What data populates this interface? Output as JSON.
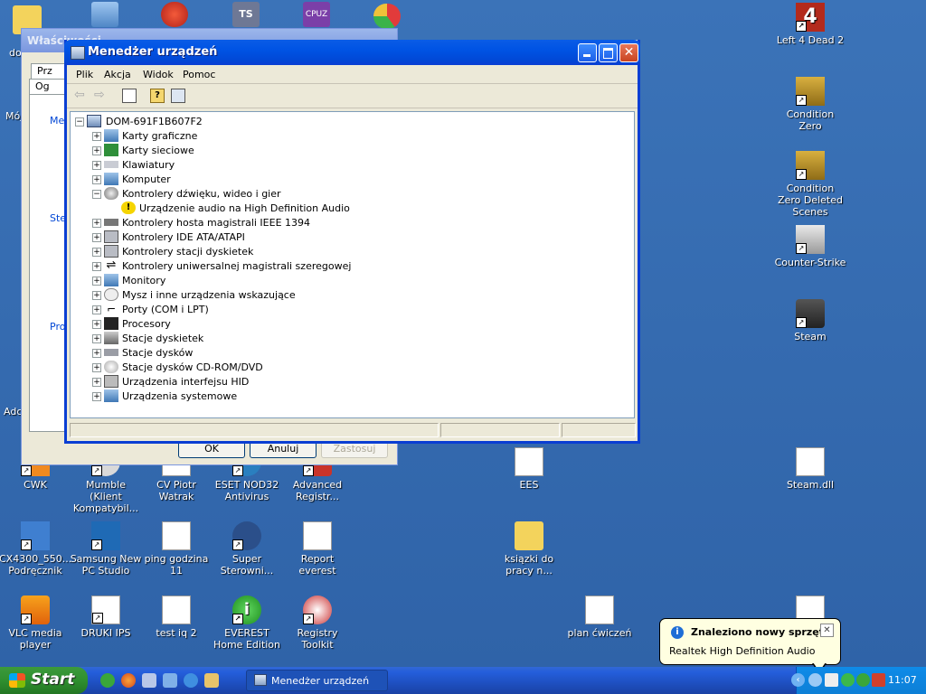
{
  "desktop": {
    "icons_right": [
      {
        "label": "Left 4 Dead 2",
        "icon": "left4dead2-icon"
      },
      {
        "label": "Condition Zero",
        "icon": "condition-zero-icon"
      },
      {
        "label": "Condition Zero Deleted Scenes",
        "icon": "condition-zero-deleted-icon"
      },
      {
        "label": "Counter-Strike",
        "icon": "counter-strike-icon"
      },
      {
        "label": "Steam",
        "icon": "steam-icon"
      },
      {
        "label": "Steam.dll",
        "icon": "dll-file-icon"
      }
    ],
    "icons_row1": [
      {
        "label": "CWK"
      },
      {
        "label": "Mumble (Klient Kompatybil..."
      },
      {
        "label": "CV Piotr Watrak"
      },
      {
        "label": "ESET NOD32 Antivirus"
      },
      {
        "label": "Advanced Registr..."
      },
      {
        "label": "EES"
      }
    ],
    "icons_row2": [
      {
        "label": "CX4300_550... Podręcznik"
      },
      {
        "label": "Samsung New PC Studio"
      },
      {
        "label": "ping godzina 11"
      },
      {
        "label": "Super Sterowni..."
      },
      {
        "label": "Report everest"
      },
      {
        "label": "ksiązki do pracy n..."
      }
    ],
    "icons_row3": [
      {
        "label": "VLC media player"
      },
      {
        "label": "DRUKI IPS"
      },
      {
        "label": "test iq 2"
      },
      {
        "label": "EVEREST Home Edition"
      },
      {
        "label": "Registry Toolkit"
      },
      {
        "label": "plan ćwiczeń"
      }
    ],
    "left_partial_labels": [
      "do",
      "Mój",
      "Adc"
    ]
  },
  "props_window": {
    "title": "Właściwości",
    "tab1": "Prz",
    "tab2": "Og",
    "group1": "Me",
    "group2": "Ste",
    "group3": "Pro",
    "ok": "OK",
    "cancel": "Anuluj",
    "apply": "Zastosuj"
  },
  "device_manager": {
    "title": "Menedżer urządzeń",
    "menu": [
      "Plik",
      "Akcja",
      "Widok",
      "Pomoc"
    ],
    "root": "DOM-691F1B607F2",
    "nodes": [
      {
        "label": "Karty graficzne",
        "expanded": false
      },
      {
        "label": "Karty sieciowe",
        "expanded": false
      },
      {
        "label": "Klawiatury",
        "expanded": false
      },
      {
        "label": "Komputer",
        "expanded": false
      },
      {
        "label": "Kontrolery dźwięku, wideo i gier",
        "expanded": true
      },
      {
        "label": "Urządzenie audio na High Definition Audio",
        "child": true,
        "warning": true
      },
      {
        "label": "Kontrolery hosta magistrali IEEE 1394",
        "expanded": false
      },
      {
        "label": "Kontrolery IDE ATA/ATAPI",
        "expanded": false
      },
      {
        "label": "Kontrolery stacji dyskietek",
        "expanded": false
      },
      {
        "label": "Kontrolery uniwersalnej magistrali szeregowej",
        "expanded": false
      },
      {
        "label": "Monitory",
        "expanded": false
      },
      {
        "label": "Mysz i inne urządzenia wskazujące",
        "expanded": false
      },
      {
        "label": "Porty (COM i LPT)",
        "expanded": false
      },
      {
        "label": "Procesory",
        "expanded": false
      },
      {
        "label": "Stacje dyskietek",
        "expanded": false
      },
      {
        "label": "Stacje dysków",
        "expanded": false
      },
      {
        "label": "Stacje dysków CD-ROM/DVD",
        "expanded": false
      },
      {
        "label": "Urządzenia interfejsu HID",
        "expanded": false
      },
      {
        "label": "Urządzenia systemowe",
        "expanded": false
      }
    ]
  },
  "balloon": {
    "title": "Znaleziono nowy sprzęt",
    "text": "Realtek High Definition Audio",
    "close": "✕"
  },
  "taskbar": {
    "start": "Start",
    "task": "Menedżer urządzeń",
    "clock": "11:07"
  },
  "colors": {
    "desktop": "#3a6ea5",
    "titlebar": "#0053e4",
    "start": "#2f8f2f",
    "window_bg": "#ece9d8"
  }
}
